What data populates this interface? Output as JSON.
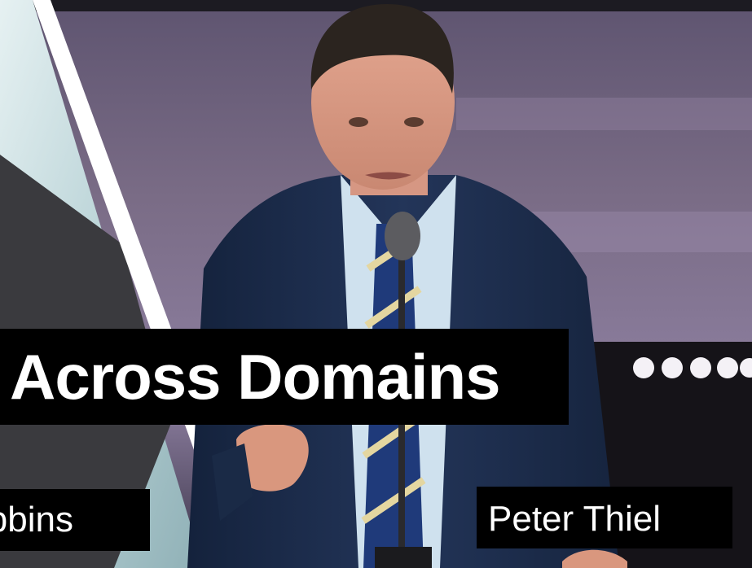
{
  "title": "Across Domains",
  "captions": {
    "left": "Tony Robbins",
    "right": "Peter Thiel"
  },
  "colors": {
    "caption_bg": "#000000",
    "caption_text": "#ffffff",
    "suit": "#1c2c4a",
    "stage_backdrop": "#6b5f78"
  }
}
